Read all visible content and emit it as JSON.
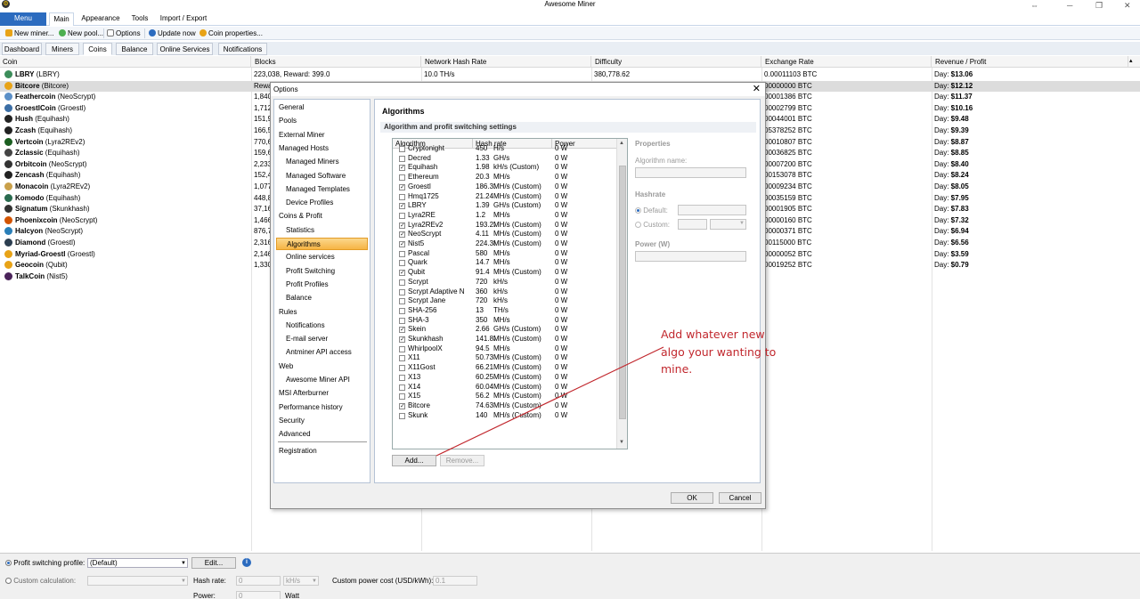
{
  "window": {
    "title": "Awesome Miner"
  },
  "ribbon": {
    "tabs": [
      "Menu",
      "Main",
      "Appearance",
      "Tools",
      "Import / Export"
    ]
  },
  "toolbar": {
    "new_miner": "New miner...",
    "new_pool": "New pool...",
    "options": "Options",
    "update": "Update now",
    "coin_props": "Coin properties..."
  },
  "subtabs": [
    "Dashboard",
    "Miners",
    "Coins",
    "Balance",
    "Online Services",
    "Notifications"
  ],
  "grid": {
    "columns": [
      "Coin",
      "Blocks",
      "Network Hash Rate",
      "Difficulty",
      "Exchange Rate",
      "Revenue / Profit"
    ],
    "rows": [
      {
        "name": "LBRY",
        "algo": " (LBRY)",
        "blocks": "223,038, Reward: 399.0",
        "hash": "10.0 TH/s",
        "diff": "380,778.62",
        "rate": "0.00011103 BTC",
        "rev_label": "Day: ",
        "rev": "$13.06",
        "color": "#3c8d5a"
      },
      {
        "name": "Bitcore",
        "algo": " (Bitcore)",
        "blocks": "Rewa",
        "hash": "",
        "diff": "",
        "rate": "00000000 BTC",
        "rev_label": "Day: ",
        "rev": "$12.12",
        "color": "#e8a317",
        "selected": true
      },
      {
        "name": "Feathercoin",
        "algo": " (NeoScrypt)",
        "blocks": "1,840",
        "hash": "",
        "diff": "",
        "rate": "00001386 BTC",
        "rev_label": "Day: ",
        "rev": "$11.37",
        "color": "#5b8fc7"
      },
      {
        "name": "GroestlCoin",
        "algo": " (Groestl)",
        "blocks": "1,712",
        "hash": "",
        "diff": "",
        "rate": "00002799 BTC",
        "rev_label": "Day: ",
        "rev": "$10.16",
        "color": "#3b6ea5"
      },
      {
        "name": "Hush",
        "algo": " (Equihash)",
        "blocks": "151,9",
        "hash": "",
        "diff": "",
        "rate": "00044001 BTC",
        "rev_label": "Day: ",
        "rev": "$9.48",
        "color": "#222"
      },
      {
        "name": "Zcash",
        "algo": " (Equihash)",
        "blocks": "166,5",
        "hash": "",
        "diff": "",
        "rate": "05378252 BTC",
        "rev_label": "Day: ",
        "rev": "$9.39",
        "color": "#222"
      },
      {
        "name": "Vertcoin",
        "algo": " (Lyra2REv2)",
        "blocks": "770,6",
        "hash": "",
        "diff": "",
        "rate": "00010807 BTC",
        "rev_label": "Day: ",
        "rev": "$8.87",
        "color": "#1b5e20"
      },
      {
        "name": "Zclassic",
        "algo": " (Equihash)",
        "blocks": "159,6",
        "hash": "",
        "diff": "",
        "rate": "00036825 BTC",
        "rev_label": "Day: ",
        "rev": "$8.85",
        "color": "#444"
      },
      {
        "name": "Orbitcoin",
        "algo": " (NeoScrypt)",
        "blocks": "2,233",
        "hash": "",
        "diff": "",
        "rate": "00007200 BTC",
        "rev_label": "Day: ",
        "rev": "$8.40",
        "color": "#333"
      },
      {
        "name": "Zencash",
        "algo": " (Equihash)",
        "blocks": "152,4",
        "hash": "",
        "diff": "",
        "rate": "00153078 BTC",
        "rev_label": "Day: ",
        "rev": "$8.24",
        "color": "#222"
      },
      {
        "name": "Monacoin",
        "algo": " (Lyra2REv2)",
        "blocks": "1,077",
        "hash": "",
        "diff": "",
        "rate": "00009234 BTC",
        "rev_label": "Day: ",
        "rev": "$8.05",
        "color": "#c9a04a"
      },
      {
        "name": "Komodo",
        "algo": " (Equihash)",
        "blocks": "448,8",
        "hash": "",
        "diff": "",
        "rate": "00035159 BTC",
        "rev_label": "Day: ",
        "rev": "$7.95",
        "color": "#2a6b4f"
      },
      {
        "name": "Signatum",
        "algo": " (Skunkhash)",
        "blocks": "37,16",
        "hash": "",
        "diff": "",
        "rate": "00001905 BTC",
        "rev_label": "Day: ",
        "rev": "$7.83",
        "color": "#333"
      },
      {
        "name": "Phoenixcoin",
        "algo": " (NeoScrypt)",
        "blocks": "1,466",
        "hash": "",
        "diff": "",
        "rate": "00000160 BTC",
        "rev_label": "Day: ",
        "rev": "$7.32",
        "color": "#d35400"
      },
      {
        "name": "Halcyon",
        "algo": " (NeoScrypt)",
        "blocks": "876,7",
        "hash": "",
        "diff": "",
        "rate": "00000371 BTC",
        "rev_label": "Day: ",
        "rev": "$6.94",
        "color": "#2a7fb8"
      },
      {
        "name": "Diamond",
        "algo": " (Groestl)",
        "blocks": "2,316",
        "hash": "",
        "diff": "",
        "rate": "00115000 BTC",
        "rev_label": "Day: ",
        "rev": "$6.56",
        "color": "#2c3e50"
      },
      {
        "name": "Myriad-Groestl",
        "algo": " (Groestl)",
        "blocks": "2,146",
        "hash": "",
        "diff": "",
        "rate": "00000052 BTC",
        "rev_label": "Day: ",
        "rev": "$3.59",
        "color": "#e8a317"
      },
      {
        "name": "Geocoin",
        "algo": " (Qubit)",
        "blocks": "1,330",
        "hash": "",
        "diff": "",
        "rate": "00019252 BTC",
        "rev_label": "Day: ",
        "rev": "$0.79",
        "color": "#e8a317"
      },
      {
        "name": "TalkCoin",
        "algo": " (Nist5)",
        "blocks": "",
        "hash": "",
        "diff": "",
        "rate": "",
        "rev_label": "",
        "rev": "",
        "color": "#4a235a"
      }
    ]
  },
  "bottom": {
    "profit_profile_label": "Profit switching profile:",
    "profit_profile_value": "(Default)",
    "edit": "Edit...",
    "custom_calc": "Custom calculation:",
    "hash_rate": "Hash rate:",
    "hash_value": "0",
    "hash_unit": "kH/s",
    "power": "Power:",
    "power_value": "0",
    "power_unit": "Watt",
    "cost_label": "Custom power cost (USD/kWh):",
    "cost_value": "0.1"
  },
  "dialog": {
    "title": "Options",
    "nav": [
      {
        "label": "General",
        "level": 0
      },
      {
        "label": "Pools",
        "level": 0
      },
      {
        "label": "External Miner",
        "level": 0
      },
      {
        "label": "Managed Hosts",
        "level": 0
      },
      {
        "label": "Managed Miners",
        "level": 1
      },
      {
        "label": "Managed Software",
        "level": 1
      },
      {
        "label": "Managed Templates",
        "level": 1
      },
      {
        "label": "Device Profiles",
        "level": 1
      },
      {
        "label": "Coins & Profit",
        "level": 0
      },
      {
        "label": "Statistics",
        "level": 1
      },
      {
        "label": "Algorithms",
        "level": 1,
        "active": true
      },
      {
        "label": "Online services",
        "level": 1
      },
      {
        "label": "Profit Switching",
        "level": 1
      },
      {
        "label": "Profit Profiles",
        "level": 1
      },
      {
        "label": "Balance",
        "level": 1
      },
      {
        "label": "Rules",
        "level": 0
      },
      {
        "label": "Notifications",
        "level": 1
      },
      {
        "label": "E-mail server",
        "level": 1
      },
      {
        "label": "Antminer API access",
        "level": 1
      },
      {
        "label": "Web",
        "level": 0
      },
      {
        "label": "Awesome Miner API",
        "level": 1
      },
      {
        "label": "MSI Afterburner",
        "level": 0
      },
      {
        "label": "Performance history",
        "level": 0
      },
      {
        "label": "Security",
        "level": 0
      },
      {
        "label": "Advanced",
        "level": 0
      },
      {
        "label": "Registration",
        "level": 0
      }
    ],
    "content_title": "Algorithms",
    "content_subtitle": "Algorithm and profit switching settings",
    "algo_columns": [
      "Algorithm",
      "Hash rate",
      "Power"
    ],
    "algos": [
      {
        "name": "Cryptonight",
        "value": "450",
        "unit": "H/s",
        "power": "0 W",
        "checked": false
      },
      {
        "name": "Decred",
        "value": "1.33",
        "unit": "GH/s",
        "power": "0 W",
        "checked": false
      },
      {
        "name": "Equihash",
        "value": "1.98",
        "unit": "kH/s  (Custom)",
        "power": "0 W",
        "checked": true
      },
      {
        "name": "Ethereum",
        "value": "20.3",
        "unit": "MH/s",
        "power": "0 W",
        "checked": false
      },
      {
        "name": "Groestl",
        "value": "186.31",
        "unit": "MH/s  (Custom)",
        "power": "0 W",
        "checked": true
      },
      {
        "name": "Hmq1725",
        "value": "21.24",
        "unit": "MH/s  (Custom)",
        "power": "0 W",
        "checked": false
      },
      {
        "name": "LBRY",
        "value": "1.39",
        "unit": "GH/s  (Custom)",
        "power": "0 W",
        "checked": true
      },
      {
        "name": "Lyra2RE",
        "value": "1.2",
        "unit": "MH/s",
        "power": "0 W",
        "checked": false
      },
      {
        "name": "Lyra2REv2",
        "value": "193.27",
        "unit": "MH/s  (Custom)",
        "power": "0 W",
        "checked": true
      },
      {
        "name": "NeoScrypt",
        "value": "4.11",
        "unit": "MH/s  (Custom)",
        "power": "0 W",
        "checked": true
      },
      {
        "name": "Nist5",
        "value": "224.38",
        "unit": "MH/s  (Custom)",
        "power": "0 W",
        "checked": true
      },
      {
        "name": "Pascal",
        "value": "580",
        "unit": "MH/s",
        "power": "0 W",
        "checked": false
      },
      {
        "name": "Quark",
        "value": "14.7",
        "unit": "MH/s",
        "power": "0 W",
        "checked": false
      },
      {
        "name": "Qubit",
        "value": "91.4",
        "unit": "MH/s  (Custom)",
        "power": "0 W",
        "checked": true
      },
      {
        "name": "Scrypt",
        "value": "720",
        "unit": "kH/s",
        "power": "0 W",
        "checked": false
      },
      {
        "name": "Scrypt Adaptive N",
        "value": "360",
        "unit": "kH/s",
        "power": "0 W",
        "checked": false
      },
      {
        "name": "Scrypt Jane",
        "value": "720",
        "unit": "kH/s",
        "power": "0 W",
        "checked": false
      },
      {
        "name": "SHA-256",
        "value": "13",
        "unit": "TH/s",
        "power": "0 W",
        "checked": false
      },
      {
        "name": "SHA-3",
        "value": "350",
        "unit": "MH/s",
        "power": "0 W",
        "checked": false
      },
      {
        "name": "Skein",
        "value": "2.66",
        "unit": "GH/s  (Custom)",
        "power": "0 W",
        "checked": true
      },
      {
        "name": "Skunkhash",
        "value": "141.82",
        "unit": "MH/s  (Custom)",
        "power": "0 W",
        "checked": true
      },
      {
        "name": "WhirlpoolX",
        "value": "94.5",
        "unit": "MH/s",
        "power": "0 W",
        "checked": false
      },
      {
        "name": "X11",
        "value": "50.73",
        "unit": "MH/s  (Custom)",
        "power": "0 W",
        "checked": false
      },
      {
        "name": "X11Gost",
        "value": "66.21",
        "unit": "MH/s  (Custom)",
        "power": "0 W",
        "checked": false
      },
      {
        "name": "X13",
        "value": "60.25",
        "unit": "MH/s  (Custom)",
        "power": "0 W",
        "checked": false
      },
      {
        "name": "X14",
        "value": "60.04",
        "unit": "MH/s  (Custom)",
        "power": "0 W",
        "checked": false
      },
      {
        "name": "X15",
        "value": "56.2",
        "unit": "MH/s  (Custom)",
        "power": "0 W",
        "checked": false
      },
      {
        "name": "Bitcore",
        "value": "74.63",
        "unit": "MH/s  (Custom)",
        "power": "0 W",
        "checked": true
      },
      {
        "name": "Skunk",
        "value": "140",
        "unit": "MH/s  (Custom)",
        "power": "0 W",
        "checked": false
      }
    ],
    "add": "Add...",
    "remove": "Remove...",
    "properties": "Properties",
    "algo_name_label": "Algorithm name:",
    "hashrate_label": "Hashrate",
    "default_label": "Default:",
    "custom_label": "Custom:",
    "power_label": "Power (W)",
    "ok": "OK",
    "cancel": "Cancel"
  },
  "annotation": {
    "text": "Add whatever new algo your wanting to mine.",
    "color": "#c1272d"
  }
}
